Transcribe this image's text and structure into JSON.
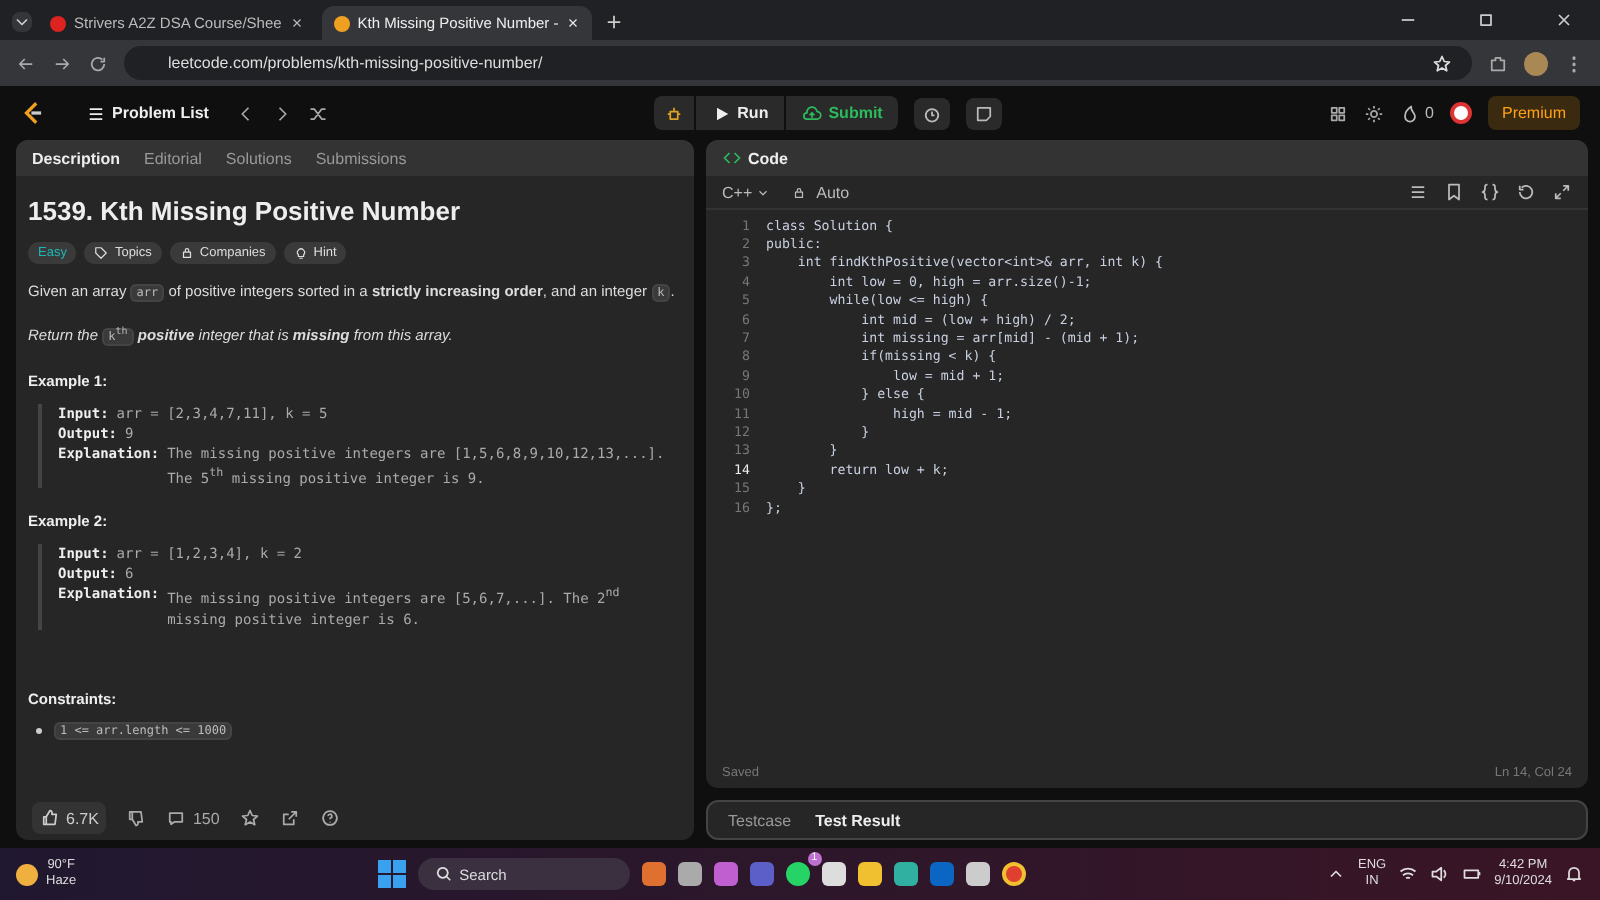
{
  "browser": {
    "tabs": [
      {
        "title": "Strivers A2Z DSA Course/Shee",
        "selected": false
      },
      {
        "title": "Kth Missing Positive Number -",
        "selected": true
      }
    ],
    "url": "leetcode.com/problems/kth-missing-positive-number/"
  },
  "navbar": {
    "problem_list": "Problem List",
    "run": "Run",
    "submit": "Submit",
    "streak": "0",
    "premium": "Premium"
  },
  "left_tabs": [
    {
      "label": "Description",
      "selected": true
    },
    {
      "label": "Editorial",
      "selected": false
    },
    {
      "label": "Solutions",
      "selected": false
    },
    {
      "label": "Submissions",
      "selected": false
    }
  ],
  "problem": {
    "title": "1539. Kth Missing Positive Number",
    "difficulty": "Easy",
    "tags": [
      "Topics",
      "Companies",
      "Hint"
    ],
    "statement": [
      [
        {
          "kind": "plain",
          "text": "Given an array "
        },
        {
          "kind": "code",
          "text": "arr"
        },
        {
          "kind": "plain",
          "text": " of positive integers sorted in a **strictly increasing order**, and an integer "
        },
        {
          "kind": "code",
          "text": "k"
        },
        {
          "kind": "plain",
          "text": "."
        }
      ],
      [
        {
          "kind": "plain",
          "text": "Return the "
        },
        {
          "kind": "code",
          "text": "k$^{th}$"
        },
        {
          "kind": "plain",
          "text": " **positive** integer that is **missing** from this array."
        }
      ]
    ],
    "examples": [
      {
        "title": "Example 1:",
        "lines": [
          {
            "label": "Input:",
            "value": "arr = [2,3,4,7,11], k = 5"
          },
          {
            "label": "Output:",
            "value": "9"
          },
          {
            "label": "Explanation:",
            "value": "The missing positive integers are [1,5,6,8,9,10,12,13,...]. The 5$^{th}$ missing positive integer is 9."
          }
        ]
      },
      {
        "title": "Example 2:",
        "lines": [
          {
            "label": "Input:",
            "value": "arr = [1,2,3,4], k = 2"
          },
          {
            "label": "Output:",
            "value": "6"
          },
          {
            "label": "Explanation:",
            "value": "The missing positive integers are [5,6,7,...]. The 2$^{nd}$ missing positive integer is 6."
          }
        ]
      }
    ],
    "constraints_title": "Constraints:",
    "constraints": [
      "1 <= arr.length <= 1000"
    ]
  },
  "left_footer": {
    "likes": "6.7K",
    "comments": "150"
  },
  "code_panel": {
    "title": "Code",
    "language": "C++",
    "mode": "Auto",
    "status": "Saved",
    "cursor": "Ln 14, Col 24",
    "lines": [
      {
        "number": "1",
        "text": "class Solution {",
        "current": false
      },
      {
        "number": "2",
        "text": "public:",
        "current": false
      },
      {
        "number": "3",
        "text": "    int findKthPositive(vector<int>& arr, int k) {",
        "current": false
      },
      {
        "number": "4",
        "text": "        int low = 0, high = arr.size()-1;",
        "current": false
      },
      {
        "number": "5",
        "text": "        while(low <= high) {",
        "current": false
      },
      {
        "number": "6",
        "text": "            int mid = (low + high) / 2;",
        "current": false
      },
      {
        "number": "7",
        "text": "            int missing = arr[mid] - (mid + 1);",
        "current": false
      },
      {
        "number": "8",
        "text": "            if(missing < k) {",
        "current": false
      },
      {
        "number": "9",
        "text": "                low = mid + 1;",
        "current": false
      },
      {
        "number": "10",
        "text": "            } else {",
        "current": false
      },
      {
        "number": "11",
        "text": "                high = mid - 1;",
        "current": false
      },
      {
        "number": "12",
        "text": "            }",
        "current": false
      },
      {
        "number": "13",
        "text": "        }",
        "current": false
      },
      {
        "number": "14",
        "text": "        return low + k;",
        "current": true
      },
      {
        "number": "15",
        "text": "    }",
        "current": false
      },
      {
        "number": "16",
        "text": "};",
        "current": false
      }
    ]
  },
  "bottom_tabs": [
    {
      "label": "Testcase",
      "selected": false
    },
    {
      "label": "Test Result",
      "selected": true
    }
  ],
  "taskbar": {
    "temperature": "90°F",
    "weather": "Haze",
    "search": "Search",
    "language": "ENG",
    "region": "IN",
    "time": "4:42 PM",
    "date": "9/10/2024",
    "whatsapp_badge": "1"
  }
}
